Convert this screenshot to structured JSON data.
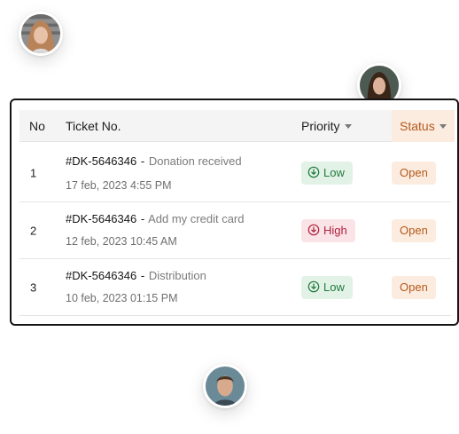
{
  "table": {
    "headers": {
      "no": "No",
      "ticket": "Ticket No.",
      "priority": "Priority",
      "status": "Status"
    },
    "rows": [
      {
        "no": "1",
        "ticket_id": "#DK-5646346",
        "separator": "-",
        "description": "Donation received",
        "date": "17 feb, 2023 4:55 PM",
        "priority": "Low",
        "priority_level": "low",
        "status": "Open"
      },
      {
        "no": "2",
        "ticket_id": "#DK-5646346",
        "separator": "-",
        "description": "Add my credit card",
        "date": "12 feb, 2023 10:45 AM",
        "priority": "High",
        "priority_level": "high",
        "status": "Open"
      },
      {
        "no": "3",
        "ticket_id": "#DK-5646346",
        "separator": "-",
        "description": "Distribution",
        "date": "10 feb, 2023 01:15 PM",
        "priority": "Low",
        "priority_level": "low",
        "status": "Open"
      }
    ]
  },
  "colors": {
    "low_bg": "#e3f2e7",
    "low_text": "#1f7a3c",
    "high_bg": "#fbe4e8",
    "high_text": "#b0213c",
    "open_bg": "#fcebdf",
    "open_text": "#b45a1c"
  }
}
